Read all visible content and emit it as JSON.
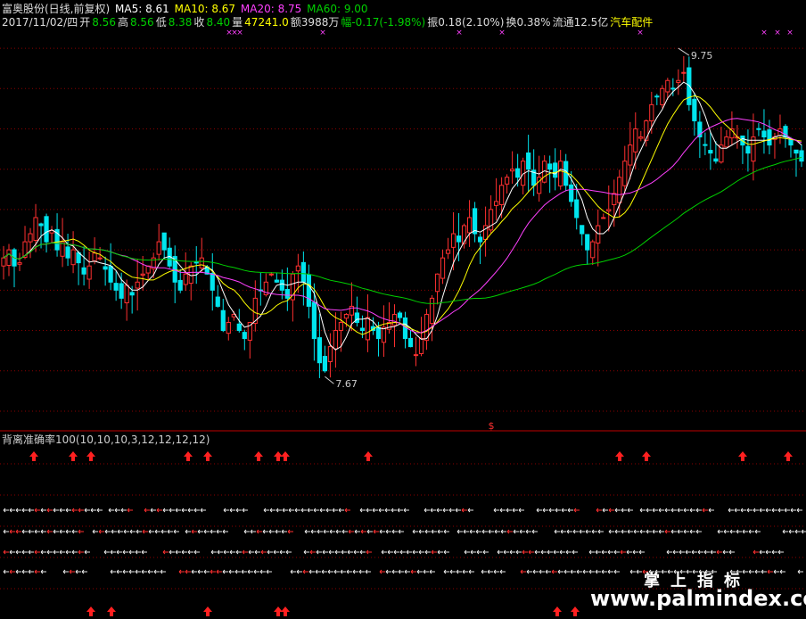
{
  "header": {
    "name": "富奥股份(日线,前复权)",
    "ma5": "MA5: 8.61",
    "ma10": "MA10: 8.67",
    "ma20": "MA20: 8.75",
    "ma60": "MA60: 9.00",
    "date": "2017/11/02/四",
    "open_lbl": "开",
    "open": "8.56",
    "high_lbl": "高",
    "high": "8.56",
    "low_lbl": "低",
    "low": "8.38",
    "close_lbl": "收",
    "close": "8.40",
    "vol_lbl": "量",
    "vol": "47241.0",
    "amount": "额3988万",
    "change": "幅-0.17(-1.98%)",
    "amp": "振0.18(2.10%)",
    "turn": "换0.38%",
    "float": "流通12.5亿",
    "sector": "汽车配件"
  },
  "indicator": {
    "title": "背离准确率100(10,10,10,3,12,12,12,12)"
  },
  "watermark": {
    "cn": "掌上指标",
    "url": "www.palmindex.com"
  },
  "colors": {
    "up": "#ff3030",
    "down": "#00e5ee",
    "ma5": "#ffffff",
    "ma10": "#ffff00",
    "ma20": "#ff40ff",
    "ma60": "#00d000",
    "grid": "#8b0000"
  },
  "chart_data": {
    "type": "candlestick",
    "price_range": [
      7.45,
      9.85
    ],
    "high_mark": "9.75",
    "low_mark": "7.67",
    "closes": [
      8.45,
      8.5,
      8.4,
      8.42,
      8.55,
      8.6,
      8.7,
      8.65,
      8.55,
      8.62,
      8.5,
      8.55,
      8.45,
      8.5,
      8.42,
      8.35,
      8.4,
      8.48,
      8.45,
      8.38,
      8.3,
      8.25,
      8.2,
      8.28,
      8.22,
      8.3,
      8.35,
      8.4,
      8.45,
      8.55,
      8.5,
      8.4,
      8.3,
      8.25,
      8.35,
      8.4,
      8.42,
      8.45,
      8.35,
      8.25,
      8.15,
      8.0,
      8.05,
      8.1,
      8.0,
      7.95,
      8.05,
      8.2,
      8.25,
      8.3,
      8.35,
      8.3,
      8.25,
      8.2,
      8.35,
      8.4,
      8.3,
      8.15,
      7.95,
      7.8,
      7.75,
      7.9,
      8.0,
      8.05,
      8.1,
      8.15,
      8.05,
      8.0,
      8.08,
      8.0,
      7.95,
      8.02,
      8.05,
      8.1,
      8.08,
      7.95,
      7.9,
      7.85,
      7.95,
      8.1,
      8.2,
      8.35,
      8.45,
      8.5,
      8.6,
      8.55,
      8.65,
      8.7,
      8.6,
      8.55,
      8.65,
      8.75,
      8.8,
      8.9,
      8.95,
      9.0,
      8.95,
      9.05,
      9.0,
      8.9,
      8.95,
      9.05,
      9.0,
      8.95,
      9.05,
      8.9,
      8.8,
      8.7,
      8.6,
      8.5,
      8.55,
      8.65,
      8.7,
      8.75,
      8.85,
      8.95,
      9.05,
      9.15,
      9.25,
      9.2,
      9.3,
      9.4,
      9.45,
      9.5,
      9.55,
      9.5,
      9.55,
      9.6,
      9.4,
      9.3,
      9.2,
      9.15,
      9.1,
      9.05,
      9.15,
      9.2,
      9.25,
      9.2,
      9.15,
      9.1,
      9.2,
      9.25,
      9.2,
      9.15,
      9.2,
      9.25,
      9.2,
      9.15,
      9.1,
      9.05
    ],
    "ma_series": [
      "MA5",
      "MA10",
      "MA20",
      "MA60"
    ],
    "signal_up_top": [
      38,
      82,
      102,
      211,
      233,
      290,
      312,
      320,
      413,
      695,
      725,
      833,
      884
    ],
    "signal_up_bottom": [
      102,
      125,
      233,
      312,
      320,
      625,
      645
    ]
  }
}
